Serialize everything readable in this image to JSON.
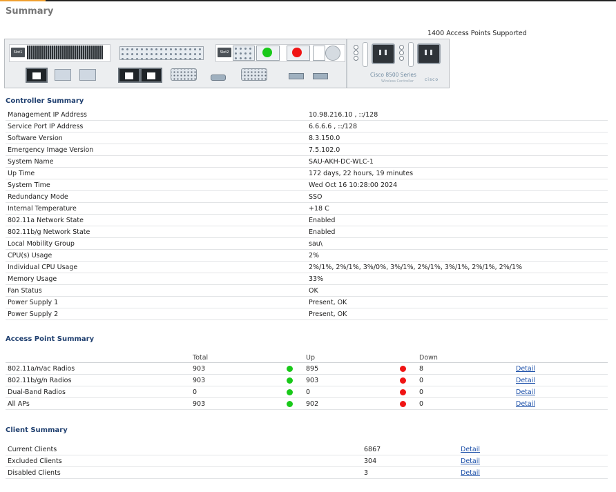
{
  "page": {
    "title": "Summary",
    "ap_supported": "1400 Access Points Supported"
  },
  "chassis": {
    "slot1_label": "Slot1",
    "slot2_label": "Slot2",
    "brand": "Cisco 8500 Series",
    "brand_sub": "Wireless Controller",
    "logo": "cisco",
    "status_leds": [
      "green",
      "red"
    ]
  },
  "controller_summary": {
    "title": "Controller Summary",
    "rows": [
      {
        "label": "Management IP Address",
        "value": "10.98.216.10 , ::/128"
      },
      {
        "label": "Service Port IP Address",
        "value": "6.6.6.6 , ::/128"
      },
      {
        "label": "Software Version",
        "value": "8.3.150.0"
      },
      {
        "label": "Emergency Image Version",
        "value": "7.5.102.0"
      },
      {
        "label": "System Name",
        "value": "SAU-AKH-DC-WLC-1"
      },
      {
        "label": "Up Time",
        "value": "172 days, 22 hours, 19 minutes"
      },
      {
        "label": "System Time",
        "value": "Wed Oct 16 10:28:00 2024"
      },
      {
        "label": "Redundancy Mode",
        "value": "SSO"
      },
      {
        "label": "Internal Temperature",
        "value": "+18 C"
      },
      {
        "label": "802.11a Network State",
        "value": "Enabled"
      },
      {
        "label": "802.11b/g Network State",
        "value": "Enabled"
      },
      {
        "label": "Local Mobility Group",
        "value": "sau\\"
      },
      {
        "label": "CPU(s) Usage",
        "value": "2%"
      },
      {
        "label": "Individual CPU Usage",
        "value": "2%/1%, 2%/1%, 3%/0%, 3%/1%, 2%/1%, 3%/1%, 2%/1%, 2%/1%"
      },
      {
        "label": "Memory Usage",
        "value": "33%"
      },
      {
        "label": "Fan Status",
        "value": "OK"
      },
      {
        "label": "Power Supply 1",
        "value": "Present, OK"
      },
      {
        "label": "Power Supply 2",
        "value": "Present, OK"
      }
    ]
  },
  "ap_summary": {
    "title": "Access Point Summary",
    "headers": {
      "total": "Total",
      "up": "Up",
      "down": "Down"
    },
    "up_color": "#19c919",
    "down_color": "#f01414",
    "rows": [
      {
        "label": "802.11a/n/ac Radios",
        "total": "903",
        "up": "895",
        "down": "8",
        "link": "Detail"
      },
      {
        "label": "802.11b/g/n Radios",
        "total": "903",
        "up": "903",
        "down": "0",
        "link": "Detail"
      },
      {
        "label": "Dual-Band Radios",
        "total": "0",
        "up": "0",
        "down": "0",
        "link": "Detail"
      },
      {
        "label": "All APs",
        "total": "903",
        "up": "902",
        "down": "0",
        "link": "Detail"
      }
    ]
  },
  "client_summary": {
    "title": "Client Summary",
    "rows": [
      {
        "label": "Current Clients",
        "value": "6867",
        "link": "Detail"
      },
      {
        "label": "Excluded Clients",
        "value": "304",
        "link": "Detail"
      },
      {
        "label": "Disabled Clients",
        "value": "3",
        "link": "Detail"
      }
    ]
  }
}
